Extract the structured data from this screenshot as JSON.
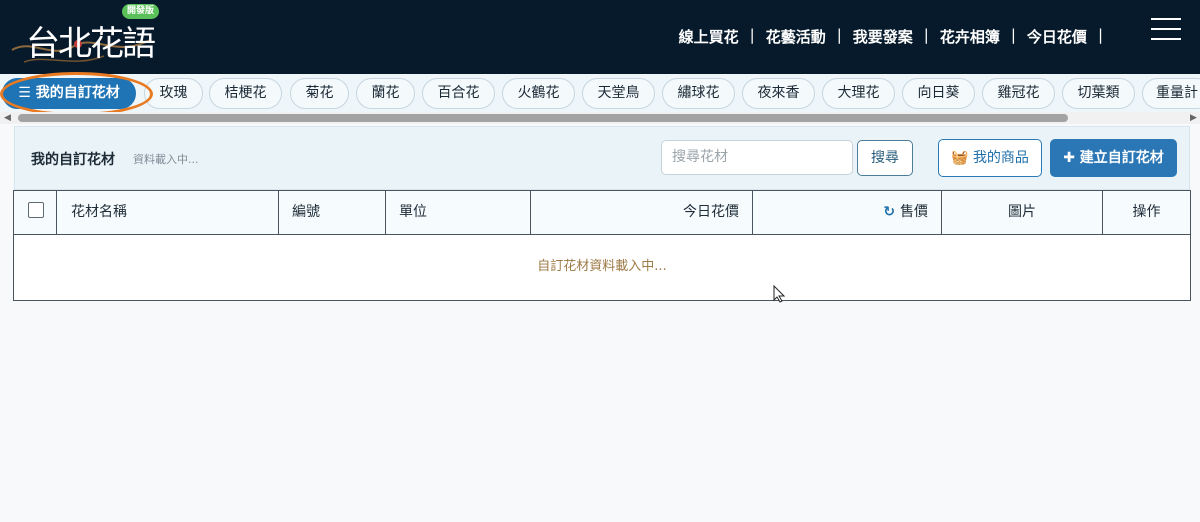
{
  "header": {
    "logo_text": "台北花語",
    "logo_badge": "開發版",
    "nav": [
      "線上買花",
      "花藝活動",
      "我要發案",
      "花卉相簿",
      "今日花價"
    ],
    "separator": "|"
  },
  "categories": [
    {
      "label": "我的自訂花材",
      "active": true
    },
    {
      "label": "玫瑰"
    },
    {
      "label": "桔梗花"
    },
    {
      "label": "菊花"
    },
    {
      "label": "蘭花"
    },
    {
      "label": "百合花"
    },
    {
      "label": "火鶴花"
    },
    {
      "label": "天堂鳥"
    },
    {
      "label": "繡球花"
    },
    {
      "label": "夜來香"
    },
    {
      "label": "大理花"
    },
    {
      "label": "向日葵"
    },
    {
      "label": "雞冠花"
    },
    {
      "label": "切葉類"
    },
    {
      "label": "重量計"
    }
  ],
  "panel": {
    "title": "我的自訂花材",
    "status": "資料載入中...",
    "search_placeholder": "搜尋花材",
    "search_button": "搜尋",
    "my_products_button": "我的商品",
    "create_button": "建立自訂花材"
  },
  "table": {
    "columns": [
      "花材名稱",
      "編號",
      "單位",
      "今日花價",
      "售價",
      "圖片",
      "操作"
    ],
    "loading": "自訂花材資料載入中..."
  },
  "colors": {
    "header_bg": "#071a2b",
    "accent": "#2b77b6",
    "highlight_ring": "#e87a22",
    "loading_text": "#9d7a46"
  }
}
